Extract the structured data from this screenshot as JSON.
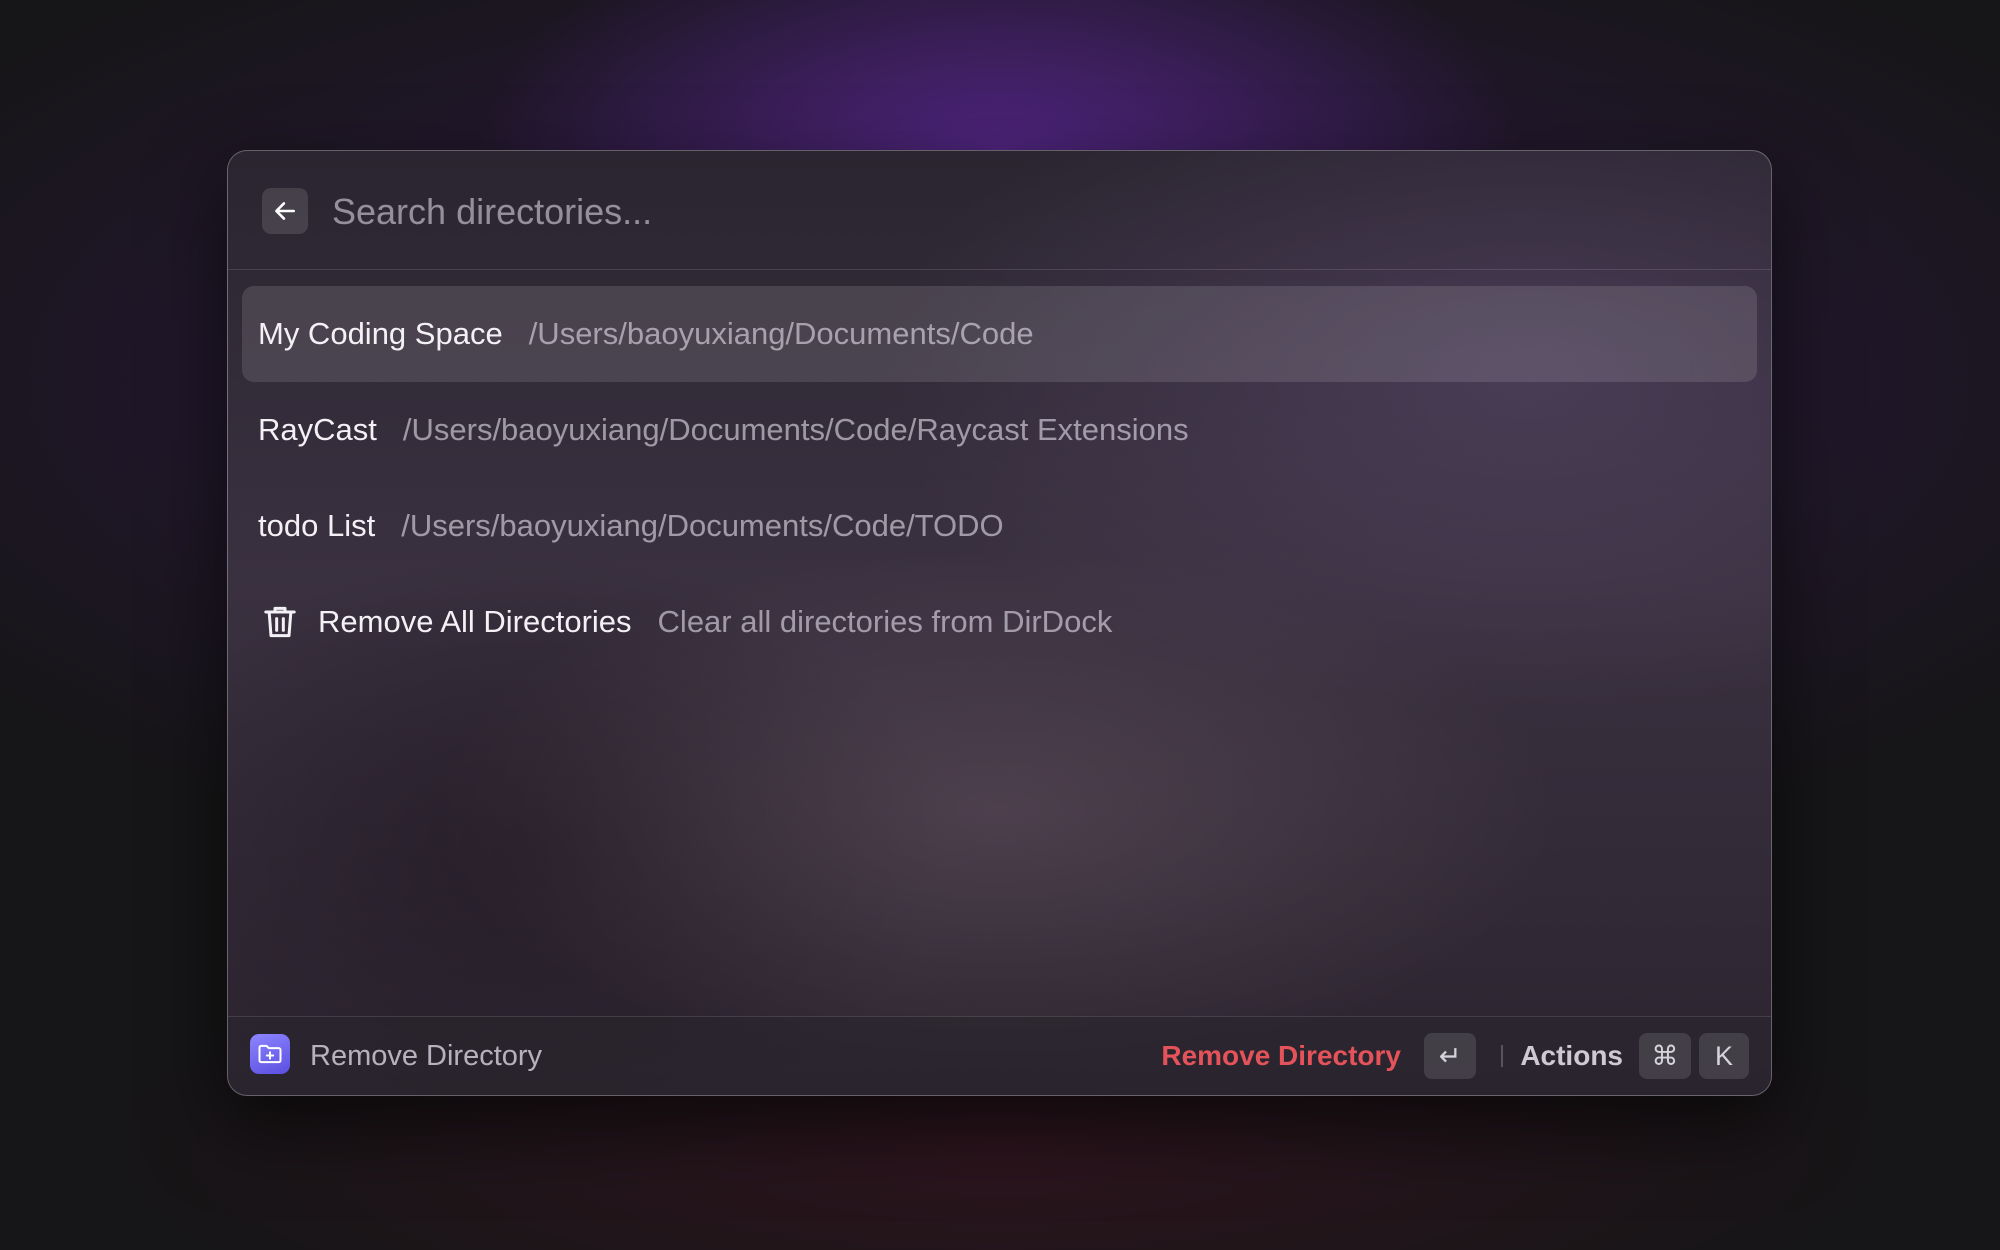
{
  "search": {
    "placeholder": "Search directories...",
    "value": ""
  },
  "list": {
    "items": [
      {
        "title": "My Coding Space",
        "subtitle": "/Users/baoyuxiang/Documents/Code",
        "selected": true
      },
      {
        "title": "RayCast",
        "subtitle": "/Users/baoyuxiang/Documents/Code/Raycast Extensions",
        "selected": false
      },
      {
        "title": "todo List",
        "subtitle": "/Users/baoyuxiang/Documents/Code/TODO",
        "selected": false
      },
      {
        "title": "Remove All Directories",
        "subtitle": "Clear all directories from DirDock",
        "icon": "trash-icon",
        "selected": false
      }
    ]
  },
  "footer": {
    "app_icon": "folder-plus-icon",
    "nav_title": "Remove Directory",
    "primary_action": "Remove Directory",
    "primary_shortcut": "↵",
    "actions_label": "Actions",
    "actions_shortcut": [
      "⌘",
      "K"
    ]
  },
  "colors": {
    "destructive": "#e5535a",
    "app_icon_gradient": [
      "#8d85ff",
      "#5a4fe0"
    ]
  }
}
